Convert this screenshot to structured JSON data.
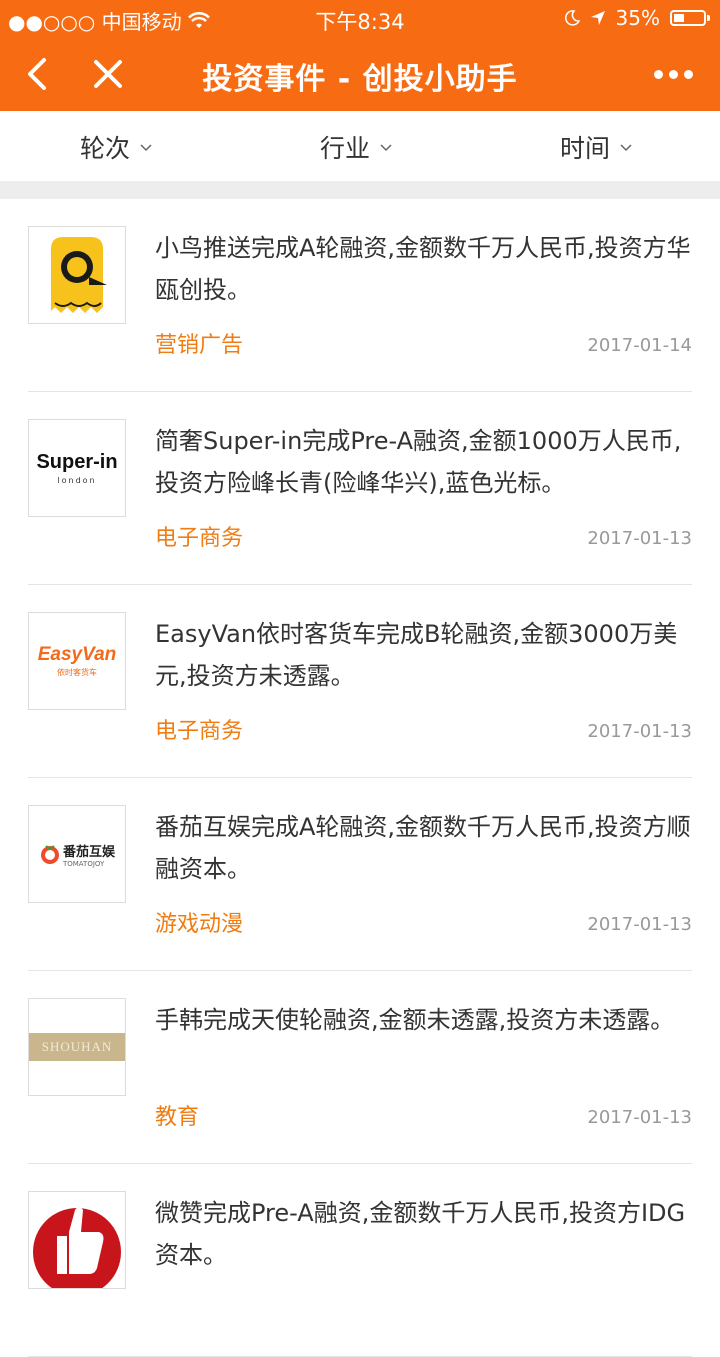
{
  "status_bar": {
    "carrier": "●●○○○ 中国移动",
    "time": "下午8:34",
    "battery": "35%",
    "battery_level": 0.35
  },
  "nav": {
    "title": "投资事件 - 创投小助手"
  },
  "filters": [
    {
      "label": "轮次"
    },
    {
      "label": "行业"
    },
    {
      "label": "时间"
    }
  ],
  "items": [
    {
      "logo": "bird-logo",
      "desc": "小鸟推送完成A轮融资,金额数千万人民币,投资方华瓯创投。",
      "tag": "营销广告",
      "date": "2017-01-14"
    },
    {
      "logo": "superin-logo",
      "logo_text": "Super-in",
      "logo_sub": "london",
      "desc": "简奢Super-in完成Pre-A融资,金额1000万人民币,投资方险峰长青(险峰华兴),蓝色光标。",
      "tag": "电子商务",
      "date": "2017-01-13"
    },
    {
      "logo": "easyvan-logo",
      "logo_text": "EasyVan",
      "logo_sub": "依时客货车",
      "desc": "EasyVan依时客货车完成B轮融资,金额3000万美元,投资方未透露。",
      "tag": "电子商务",
      "date": "2017-01-13"
    },
    {
      "logo": "tomatojoy-logo",
      "logo_text": "番茄互娱",
      "logo_sub": "TOMATOJOY",
      "desc": "番茄互娱完成A轮融资,金额数千万人民币,投资方顺融资本。",
      "tag": "游戏动漫",
      "date": "2017-01-13"
    },
    {
      "logo": "shouhan-logo",
      "logo_text": "SHOUHAN",
      "desc": "手韩完成天使轮融资,金额未透露,投资方未透露。",
      "tag": "教育",
      "date": "2017-01-13"
    },
    {
      "logo": "thumb-logo",
      "desc": "微赞完成Pre-A融资,金额数千万人民币,投资方IDG资本。",
      "tag": "",
      "date": ""
    }
  ]
}
